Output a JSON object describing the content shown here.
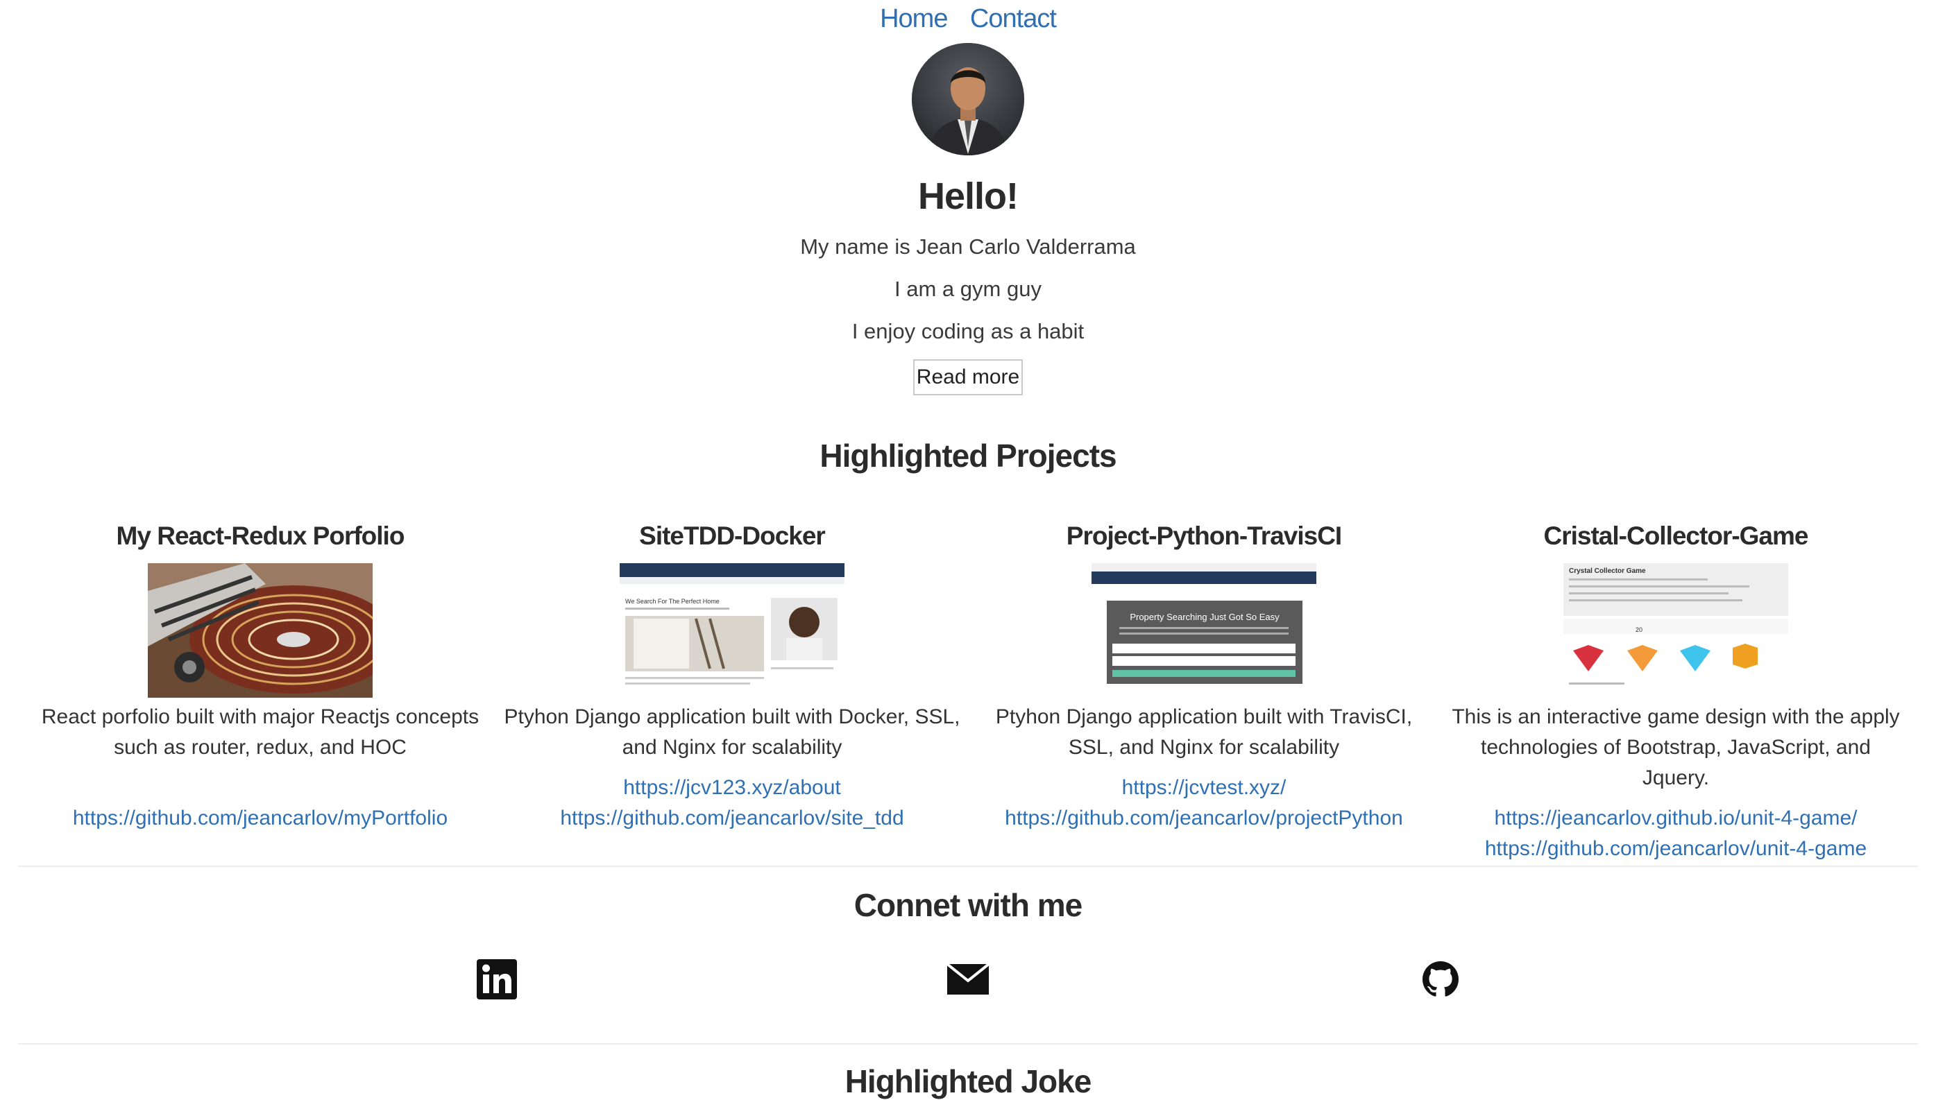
{
  "nav": {
    "home": "Home",
    "contact": "Contact"
  },
  "hero": {
    "title": "Hello!",
    "line1": "My name is Jean Carlo Valderrama",
    "line2": "I am a gym guy",
    "line3": "I enjoy coding as a habit",
    "read_more": "Read more"
  },
  "projects_section": {
    "title": "Highlighted Projects"
  },
  "projects": [
    {
      "title": "My React-Redux Porfolio",
      "description": "React porfolio built with major Reactjs concepts such as router, redux, and HOC",
      "link1": "",
      "link2": "https://github.com/jeancarlov/myPortfolio"
    },
    {
      "title": "SiteTDD-Docker",
      "description": "Ptyhon Django application built with Docker, SSL, and Nginx for scalability",
      "link1": "https://jcv123.xyz/about",
      "link2": "https://github.com/jeancarlov/site_tdd",
      "thumb_heading": "We Search For The Perfect Home"
    },
    {
      "title": "Project-Python-TravisCI",
      "description": "Ptyhon Django application built with TravisCI, SSL, and Nginx for scalability",
      "link1": "https://jcvtest.xyz/",
      "link2": "https://github.com/jeancarlov/projectPython",
      "thumb_heading": "Property Searching Just Got So Easy"
    },
    {
      "title": "Cristal-Collector-Game",
      "description": "This is an interactive game design with the apply technologies of Bootstrap, JavaScript, and Jquery.",
      "link1": "https://jeancarlov.github.io/unit-4-game/",
      "link2": "https://github.com/jeancarlov/unit-4-game",
      "thumb_heading": "Crystal Collector Game",
      "thumb_value": "20"
    }
  ],
  "connect": {
    "title": "Connet with me",
    "icons": [
      "linkedin-icon",
      "mail-icon",
      "github-icon"
    ]
  },
  "joke_section": {
    "title": "Highlighted Joke"
  },
  "colors": {
    "link": "#2f6fb3",
    "heading": "#2b2b2b",
    "divider": "#ececec"
  }
}
